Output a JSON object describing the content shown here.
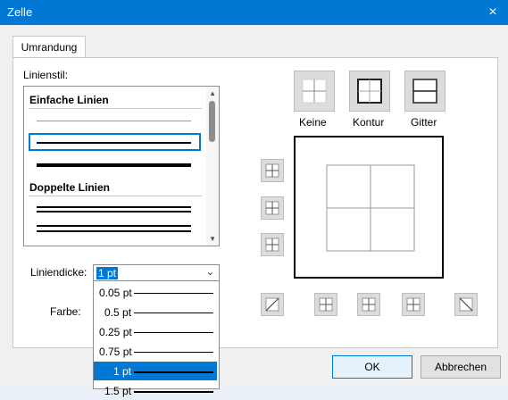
{
  "dialog": {
    "title": "Zelle",
    "close_icon": "×"
  },
  "tabs": [
    {
      "label": "Umrandung"
    }
  ],
  "line_style": {
    "label": "Linienstil:",
    "sections": [
      {
        "label": "Einfache Linien"
      },
      {
        "label": "Doppelte Linien"
      }
    ]
  },
  "presets": [
    {
      "label": "Keine",
      "icon": "border-none-icon"
    },
    {
      "label": "Kontur",
      "icon": "border-outline-icon"
    },
    {
      "label": "Gitter",
      "icon": "border-grid-icon"
    }
  ],
  "line_width": {
    "label": "Liniendicke:",
    "selected": "1 pt",
    "options": [
      "0.05 pt",
      "0.5 pt",
      "0.25 pt",
      "0.75 pt",
      "1 pt",
      "1.5 pt"
    ],
    "selected_index": 4
  },
  "color": {
    "label": "Farbe:"
  },
  "buttons": {
    "ok": "OK",
    "cancel": "Abbrechen"
  },
  "icons": {
    "close": "close-icon",
    "dropdown": "chevron-down-icon",
    "scroll_up": "scroll-up-icon",
    "scroll_down": "scroll-down-icon"
  }
}
